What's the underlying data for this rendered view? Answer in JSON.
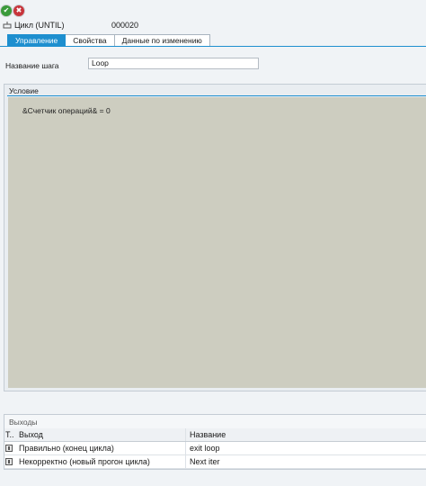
{
  "toolbar": {
    "ok_glyph": "✔",
    "cancel_glyph": "✖",
    "ok_color": "#3a9a3a",
    "cancel_color": "#c8343b"
  },
  "step": {
    "title": "Цикл (UNTIL)",
    "number": "000020"
  },
  "tabs": [
    {
      "label": "Управление",
      "active": true
    },
    {
      "label": "Свойства",
      "active": false
    },
    {
      "label": "Данные по изменению",
      "active": false
    }
  ],
  "step_name": {
    "label": "Название шага",
    "value": "Loop"
  },
  "condition": {
    "title": "Условие",
    "expression": "&Счетчик операций& = 0"
  },
  "outputs": {
    "title": "Выходы",
    "columns": {
      "t": "Т..",
      "exit": "Выход",
      "name": "Название"
    },
    "rows": [
      {
        "exit": "Правильно (конец цикла)",
        "name": "exit loop"
      },
      {
        "exit": "Некорректно (новый прогон цикла)",
        "name": "Next iter"
      }
    ]
  },
  "colors": {
    "accent": "#1e8fcf",
    "editor_bg": "#cdcdc0"
  }
}
